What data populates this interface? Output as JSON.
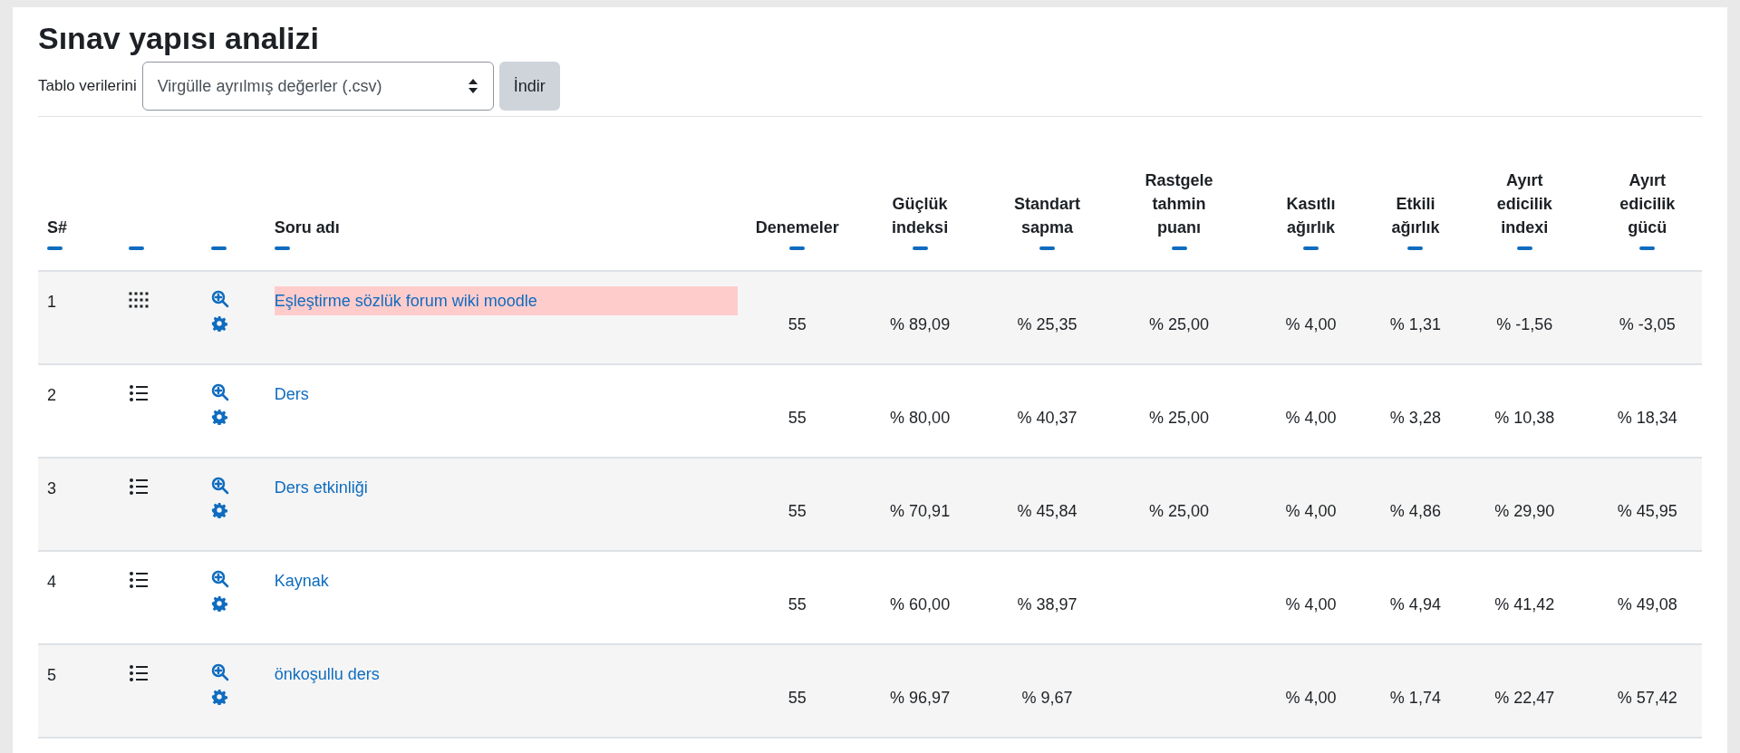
{
  "title": "Sınav yapısı analizi",
  "download": {
    "label": "Tablo verilerini",
    "format": "Virgülle ayrılmış değerler (.csv)",
    "button": "İndir"
  },
  "columns": [
    "S#",
    "",
    "",
    "Soru adı",
    "Denemeler",
    "Güçlük indeksi",
    "Standart sapma",
    "Rastgele tahmin puanı",
    "Kasıtlı ağırlık",
    "Etkili ağırlık",
    "Ayırt edicilik indexi",
    "Ayırt edicilik gücü"
  ],
  "rows": [
    {
      "number": "1",
      "kind": "matching",
      "name": "Eşleştirme sözlük forum wiki moodle",
      "flagged": true,
      "attempts": "55",
      "difficulty": "% 89,09",
      "sd": "% 25,35",
      "random_guess": "% 25,00",
      "intended_weight": "% 4,00",
      "effective_weight": "% 1,31",
      "disc_index": "% -1,56",
      "disc_efficiency": "% -3,05"
    },
    {
      "number": "2",
      "kind": "multichoice",
      "name": "Ders",
      "flagged": false,
      "attempts": "55",
      "difficulty": "% 80,00",
      "sd": "% 40,37",
      "random_guess": "% 25,00",
      "intended_weight": "% 4,00",
      "effective_weight": "% 3,28",
      "disc_index": "% 10,38",
      "disc_efficiency": "% 18,34"
    },
    {
      "number": "3",
      "kind": "multichoice",
      "name": "Ders etkinliği",
      "flagged": false,
      "attempts": "55",
      "difficulty": "% 70,91",
      "sd": "% 45,84",
      "random_guess": "% 25,00",
      "intended_weight": "% 4,00",
      "effective_weight": "% 4,86",
      "disc_index": "% 29,90",
      "disc_efficiency": "% 45,95"
    },
    {
      "number": "4",
      "kind": "multichoice",
      "name": "Kaynak",
      "flagged": false,
      "attempts": "55",
      "difficulty": "% 60,00",
      "sd": "% 38,97",
      "intended_weight": "% 4,00",
      "effective_weight": "% 4,94",
      "disc_index": "% 41,42",
      "disc_efficiency": "% 49,08"
    },
    {
      "number": "5",
      "kind": "multichoice",
      "name": "önkoşullu ders",
      "flagged": false,
      "attempts": "55",
      "difficulty": "% 96,97",
      "sd": "% 9,67",
      "intended_weight": "% 4,00",
      "effective_weight": "% 1,74",
      "disc_index": "% 22,47",
      "disc_efficiency": "% 57,42"
    }
  ]
}
